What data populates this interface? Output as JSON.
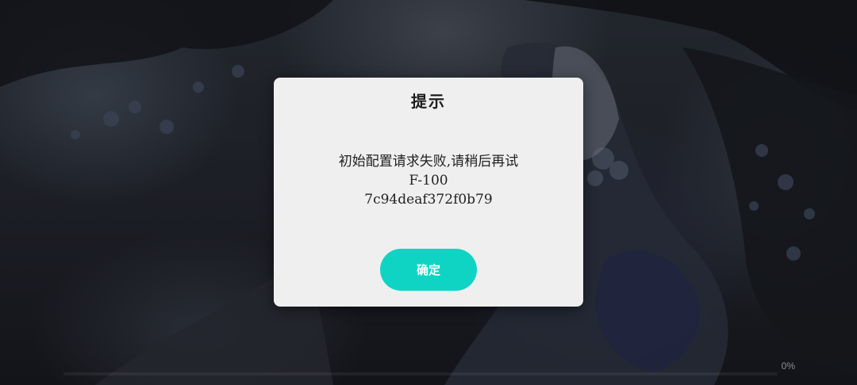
{
  "dialog": {
    "title": "提示",
    "message_lines": [
      "初始配置请求失败,请稍后再试",
      "F-100",
      "7c94deaf372f0b79"
    ],
    "confirm_label": "确定"
  },
  "loading": {
    "progress_text": "0%",
    "progress_value": 0
  },
  "colors": {
    "accent": "#0fd4c4",
    "dialog_bg": "#efefef"
  }
}
